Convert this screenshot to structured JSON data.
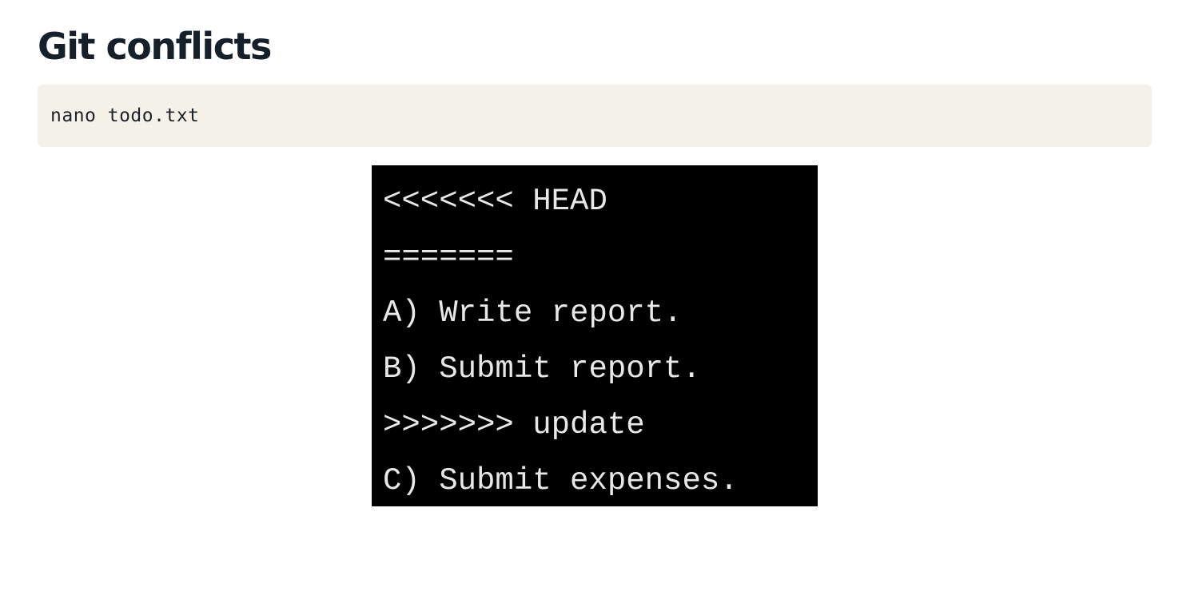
{
  "header": {
    "title": "Git conflicts"
  },
  "code": {
    "command": "nano todo.txt"
  },
  "terminal": {
    "lines": [
      "<<<<<<< HEAD",
      "=======",
      "A) Write report.",
      "B) Submit report.",
      ">>>>>>> update",
      "C) Submit expenses."
    ]
  }
}
